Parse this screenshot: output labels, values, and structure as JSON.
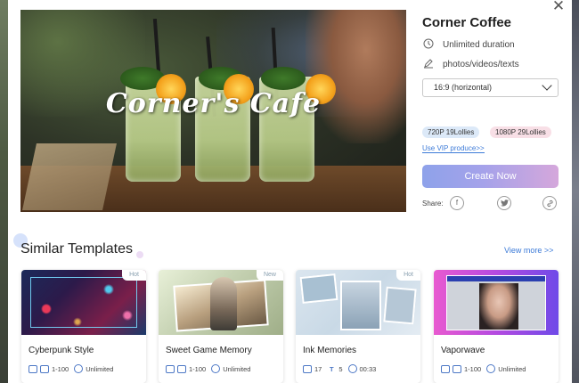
{
  "template": {
    "preview_title": "Corner's Cafe",
    "name": "Corner Coffee",
    "duration": "Unlimited duration",
    "media_types": "photos/videos/texts",
    "aspect_ratio": "16:9 (horizontal)",
    "price_tags": [
      "720P 19Lollies",
      "1080P 29Lollies"
    ],
    "vip_link": "Use VIP produce>>",
    "create_button": "Create Now",
    "share_label": "Share:"
  },
  "icons": {
    "close": "close-icon",
    "duration": "clock-icon",
    "media": "edit-icon",
    "dropdown": "chevron-down-icon",
    "share": [
      "facebook-icon",
      "twitter-icon",
      "link-icon"
    ]
  },
  "colors": {
    "accent_blue": "#3d7bd8",
    "create_gradient_start": "#8ea2ea",
    "create_gradient_end": "#d5a7db",
    "tag_720_bg": "#dce9f8",
    "tag_1080_bg": "#f8dfe6"
  },
  "similar": {
    "title": "Similar Templates",
    "view_more": "View more >>",
    "cards": [
      {
        "name": "Cyberpunk Style",
        "badge": "Hot",
        "meta": [
          "1-100",
          "Unlimited"
        ]
      },
      {
        "name": "Sweet Game Memory",
        "badge": "New",
        "meta": [
          "1-100",
          "Unlimited"
        ]
      },
      {
        "name": "Ink Memories",
        "badge": "Hot",
        "meta": [
          "17",
          "5",
          "00:33"
        ]
      },
      {
        "name": "Vaporwave",
        "badge": "",
        "meta": [
          "1-100",
          "Unlimited"
        ]
      }
    ]
  }
}
